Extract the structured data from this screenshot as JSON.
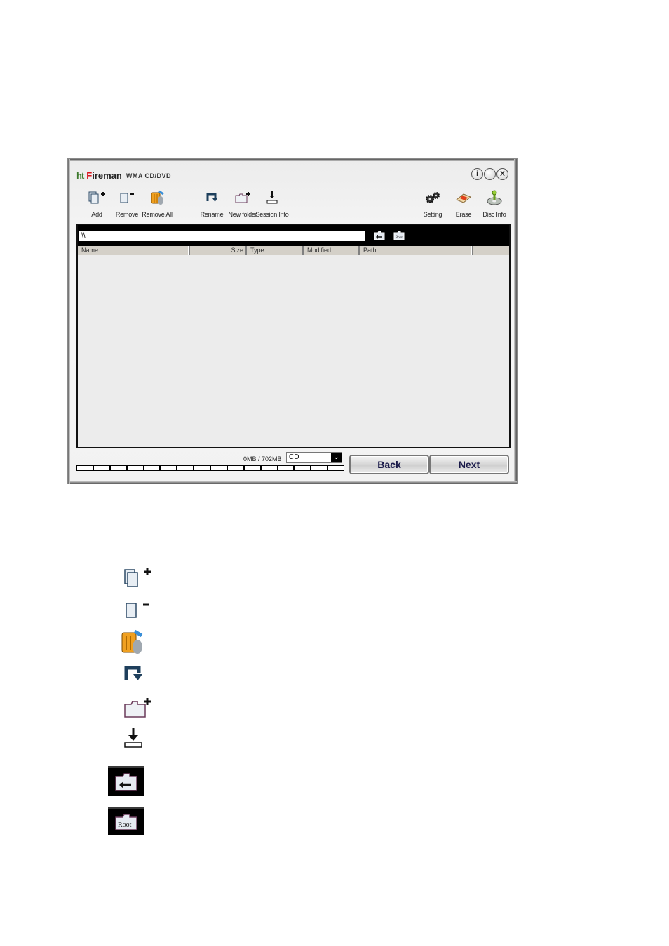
{
  "window": {
    "logo_text": "ht",
    "app_name_first": "F",
    "app_name_rest": "ireman",
    "app_subtitle": "WMA CD/DVD",
    "controls": [
      {
        "name": "info",
        "glyph": "i"
      },
      {
        "name": "minimize",
        "glyph": "–"
      },
      {
        "name": "close",
        "glyph": "X"
      }
    ]
  },
  "toolbar": {
    "add": "Add",
    "remove": "Remove",
    "remove_all": "Remove All",
    "rename": "Rename",
    "new_folder": "New folder",
    "session_info": "Session Info",
    "setting": "Setting",
    "erase": "Erase",
    "disc_info": "Disc Info"
  },
  "browser": {
    "path_value": "\\\\"
  },
  "columns": [
    "Name",
    "Size",
    "Type",
    "Modified",
    "Path",
    ""
  ],
  "files": [],
  "footer": {
    "capacity": "0MB / 702MB",
    "disc_type": "CD",
    "progress_percent": 0,
    "back": "Back",
    "next": "Next"
  },
  "legend_icons": [
    "add-icon",
    "remove-icon",
    "remove-all-icon",
    "rename-icon",
    "new-folder-icon",
    "session-info-icon",
    "parent-folder-icon",
    "root-folder-icon"
  ]
}
